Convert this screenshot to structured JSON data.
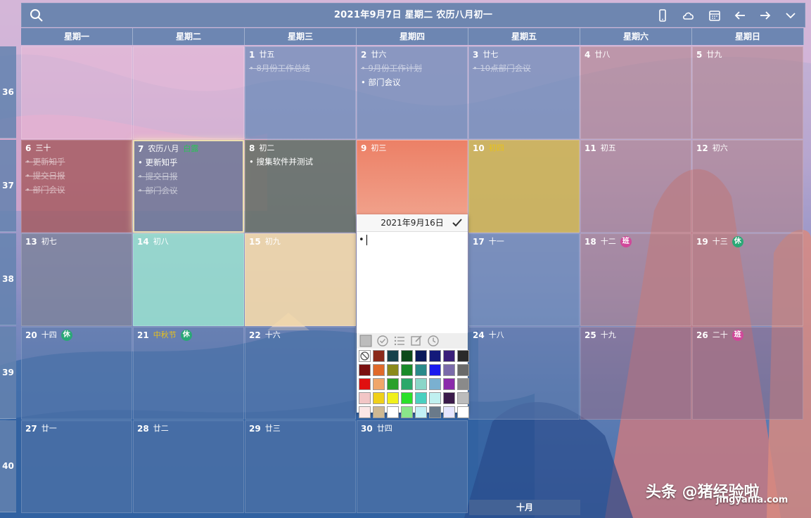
{
  "header": {
    "title": "2021年9月7日 星期二 农历八月初一"
  },
  "icons": {
    "search": "search-icon",
    "phone": "phone-icon",
    "cloud": "cloud-icon",
    "calendar": "calendar-icon",
    "back": "arrow-left-icon",
    "forward": "arrow-right-icon",
    "collapse": "chevron-down-icon"
  },
  "weekdays": [
    "星期一",
    "星期二",
    "星期三",
    "星期四",
    "星期五",
    "星期六",
    "星期日"
  ],
  "weeks": [
    "36",
    "37",
    "38",
    "39",
    "40"
  ],
  "days": {
    "d1": {
      "num": "1",
      "lunar": "廿五"
    },
    "d2": {
      "num": "2",
      "lunar": "廿六"
    },
    "d3": {
      "num": "3",
      "lunar": "廿七"
    },
    "d4": {
      "num": "4",
      "lunar": "廿八"
    },
    "d5": {
      "num": "5",
      "lunar": "廿九"
    },
    "d6": {
      "num": "6",
      "lunar": "三十"
    },
    "d7": {
      "num": "7",
      "lunar": "农历八月",
      "festival": "白露"
    },
    "d8": {
      "num": "8",
      "lunar": "初二"
    },
    "d9": {
      "num": "9",
      "lunar": "初三"
    },
    "d10": {
      "num": "10",
      "lunar": "初四"
    },
    "d11": {
      "num": "11",
      "lunar": "初五"
    },
    "d12": {
      "num": "12",
      "lunar": "初六"
    },
    "d13": {
      "num": "13",
      "lunar": "初七"
    },
    "d14": {
      "num": "14",
      "lunar": "初八"
    },
    "d15": {
      "num": "15",
      "lunar": "初九"
    },
    "d17": {
      "num": "17",
      "lunar": "十一"
    },
    "d18": {
      "num": "18",
      "lunar": "十二",
      "badge": "班"
    },
    "d19": {
      "num": "19",
      "lunar": "十三",
      "badge": "休"
    },
    "d20": {
      "num": "20",
      "lunar": "十四",
      "badge": "休"
    },
    "d21": {
      "num": "21",
      "lunar": "中秋节",
      "badge": "休"
    },
    "d22": {
      "num": "22",
      "lunar": "十六"
    },
    "d24": {
      "num": "24",
      "lunar": "十八"
    },
    "d25": {
      "num": "25",
      "lunar": "十九"
    },
    "d26": {
      "num": "26",
      "lunar": "二十",
      "badge": "班"
    },
    "d27": {
      "num": "27",
      "lunar": "廿一"
    },
    "d28": {
      "num": "28",
      "lunar": "廿二"
    },
    "d29": {
      "num": "29",
      "lunar": "廿三"
    },
    "d30": {
      "num": "30",
      "lunar": "廿四"
    }
  },
  "tasks": {
    "d1": [
      "8月份工作总结"
    ],
    "d2": [
      "9月份工作计划",
      "部门会议"
    ],
    "d3": [
      "10点部门会议"
    ],
    "d6": [
      "更新知乎",
      "提交日报",
      "部门会议"
    ],
    "d7": [
      "更新知乎",
      "提交日报",
      "部门会议"
    ],
    "d8": [
      "搜集软件并测试"
    ]
  },
  "popup": {
    "date": "2021年9月16日",
    "bullet": "•"
  },
  "colors": {
    "accent_green": "#2aa876",
    "accent_pink": "#d0489a",
    "header_bg": "#6080aa",
    "festival_green": "#2fbf5a",
    "festival_yellow": "#e8c21a",
    "swatches": [
      "none",
      "#8b2a1a",
      "#16424a",
      "#0d4a1a",
      "#0b1a5a",
      "#141a7a",
      "#3a1f7a",
      "#2a2a2a",
      "#7a1010",
      "#e06a2a",
      "#8a8a1a",
      "#1a8a2a",
      "#2a8a8a",
      "#1a1aee",
      "#7a6aaa",
      "#6a6a6a",
      "#e01010",
      "#f0a66a",
      "#2aa02a",
      "#2aa86a",
      "#8ad6c8",
      "#7ab0d0",
      "#8a2aaa",
      "#8a8a8a",
      "#f2c6c6",
      "#f0d01a",
      "#f0f01a",
      "#2ae02a",
      "#4ad0c0",
      "#c0f0f0",
      "#3a1a4a",
      "#bcbcbc",
      "#fbe6e6",
      "#cdb892",
      "#ffffff",
      "#8ae68a",
      "#c2f0f6",
      "#6a7a8a",
      "#e6e6ff",
      "#ffffff"
    ]
  },
  "footer": {
    "month_tab": "十月"
  },
  "watermark": {
    "line1": "头条 @猪经验啦",
    "line2": "jingyanla.com"
  }
}
